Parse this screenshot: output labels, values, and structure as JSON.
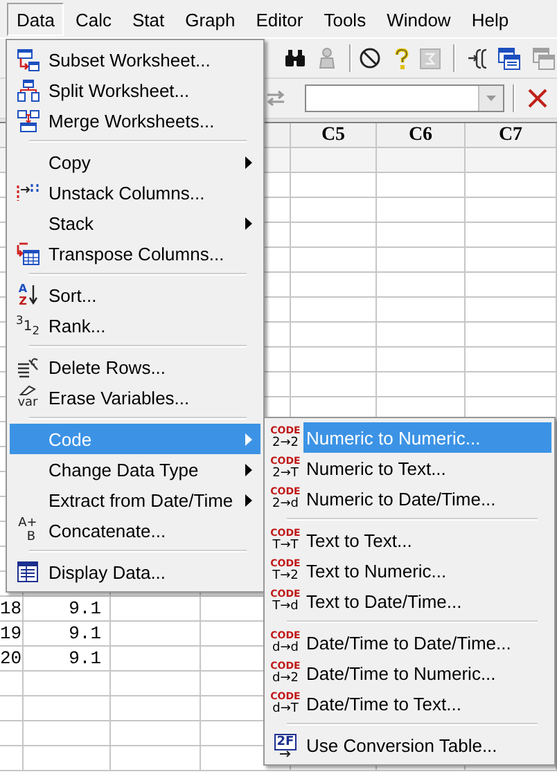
{
  "menu_bar": [
    {
      "label": "Data",
      "selected": true
    },
    {
      "label": "Calc",
      "selected": false
    },
    {
      "label": "Stat",
      "selected": false
    },
    {
      "label": "Graph",
      "selected": false
    },
    {
      "label": "Editor",
      "selected": false
    },
    {
      "label": "Tools",
      "selected": false
    },
    {
      "label": "Window",
      "selected": false
    },
    {
      "label": "Help",
      "selected": false
    }
  ],
  "worksheet": {
    "columns": [
      "C5",
      "C6",
      "C7"
    ],
    "rows": [
      {
        "number": "18",
        "value": "9.1"
      },
      {
        "number": "19",
        "value": "9.1"
      },
      {
        "number": "20",
        "value": "9.1"
      }
    ]
  },
  "data_menu": {
    "items": [
      {
        "kind": "item",
        "label": "Subset Worksheet...",
        "submenu": false,
        "selected": false
      },
      {
        "kind": "item",
        "label": "Split Worksheet...",
        "submenu": false,
        "selected": false
      },
      {
        "kind": "item",
        "label": "Merge Worksheets...",
        "submenu": false,
        "selected": false
      },
      {
        "kind": "separator"
      },
      {
        "kind": "item",
        "label": "Copy",
        "submenu": true,
        "selected": false
      },
      {
        "kind": "item",
        "label": "Unstack Columns...",
        "submenu": false,
        "selected": false
      },
      {
        "kind": "item",
        "label": "Stack",
        "submenu": true,
        "selected": false
      },
      {
        "kind": "item",
        "label": "Transpose Columns...",
        "submenu": false,
        "selected": false
      },
      {
        "kind": "separator"
      },
      {
        "kind": "item",
        "label": "Sort...",
        "icon_text": [
          "A",
          "Z"
        ],
        "submenu": false,
        "selected": false
      },
      {
        "kind": "item",
        "label": "Rank...",
        "icon_text": [
          "$^{3}$1$_{2}$"
        ],
        "submenu": false,
        "selected": false
      },
      {
        "kind": "separator"
      },
      {
        "kind": "item",
        "label": "Delete Rows...",
        "submenu": false,
        "selected": false
      },
      {
        "kind": "item",
        "label": "Erase Variables...",
        "icon_text": [
          "var"
        ],
        "submenu": false,
        "selected": false
      },
      {
        "kind": "separator"
      },
      {
        "kind": "item",
        "label": "Code",
        "submenu": true,
        "selected": true
      },
      {
        "kind": "item",
        "label": "Change Data Type",
        "submenu": true,
        "selected": false
      },
      {
        "kind": "item",
        "label": "Extract from Date/Time",
        "submenu": true,
        "selected": false
      },
      {
        "kind": "item",
        "label": "Concatenate...",
        "icon_text": [
          "A+",
          "B"
        ],
        "submenu": false,
        "selected": false
      },
      {
        "kind": "separator"
      },
      {
        "kind": "item",
        "label": "Display Data...",
        "submenu": false,
        "selected": false
      }
    ]
  },
  "code_submenu": {
    "items": [
      {
        "kind": "item",
        "label": "Numeric to Numeric...",
        "icon_text": [
          "CODE",
          "2→2"
        ],
        "submenu": false,
        "selected": true
      },
      {
        "kind": "item",
        "label": "Numeric to Text...",
        "icon_text": [
          "CODE",
          "2→T"
        ],
        "submenu": false,
        "selected": false
      },
      {
        "kind": "item",
        "label": "Numeric to Date/Time...",
        "icon_text": [
          "CODE",
          "2→d"
        ],
        "submenu": false,
        "selected": false
      },
      {
        "kind": "separator"
      },
      {
        "kind": "item",
        "label": "Text to Text...",
        "icon_text": [
          "CODE",
          "T→T"
        ],
        "submenu": false,
        "selected": false
      },
      {
        "kind": "item",
        "label": "Text to Numeric...",
        "icon_text": [
          "CODE",
          "T→2"
        ],
        "submenu": false,
        "selected": false
      },
      {
        "kind": "item",
        "label": "Text to Date/Time...",
        "icon_text": [
          "CODE",
          "T→d"
        ],
        "submenu": false,
        "selected": false
      },
      {
        "kind": "separator"
      },
      {
        "kind": "item",
        "label": "Date/Time to Date/Time...",
        "icon_text": [
          "CODE",
          "d→d"
        ],
        "submenu": false,
        "selected": false
      },
      {
        "kind": "item",
        "label": "Date/Time to Numeric...",
        "icon_text": [
          "CODE",
          "d→2"
        ],
        "submenu": false,
        "selected": false
      },
      {
        "kind": "item",
        "label": "Date/Time to Text...",
        "icon_text": [
          "CODE",
          "d→T"
        ],
        "submenu": false,
        "selected": false
      },
      {
        "kind": "separator"
      },
      {
        "kind": "item",
        "label": "Use Conversion Table...",
        "icon_text": [
          "2F"
        ],
        "submenu": false,
        "selected": false
      }
    ]
  }
}
